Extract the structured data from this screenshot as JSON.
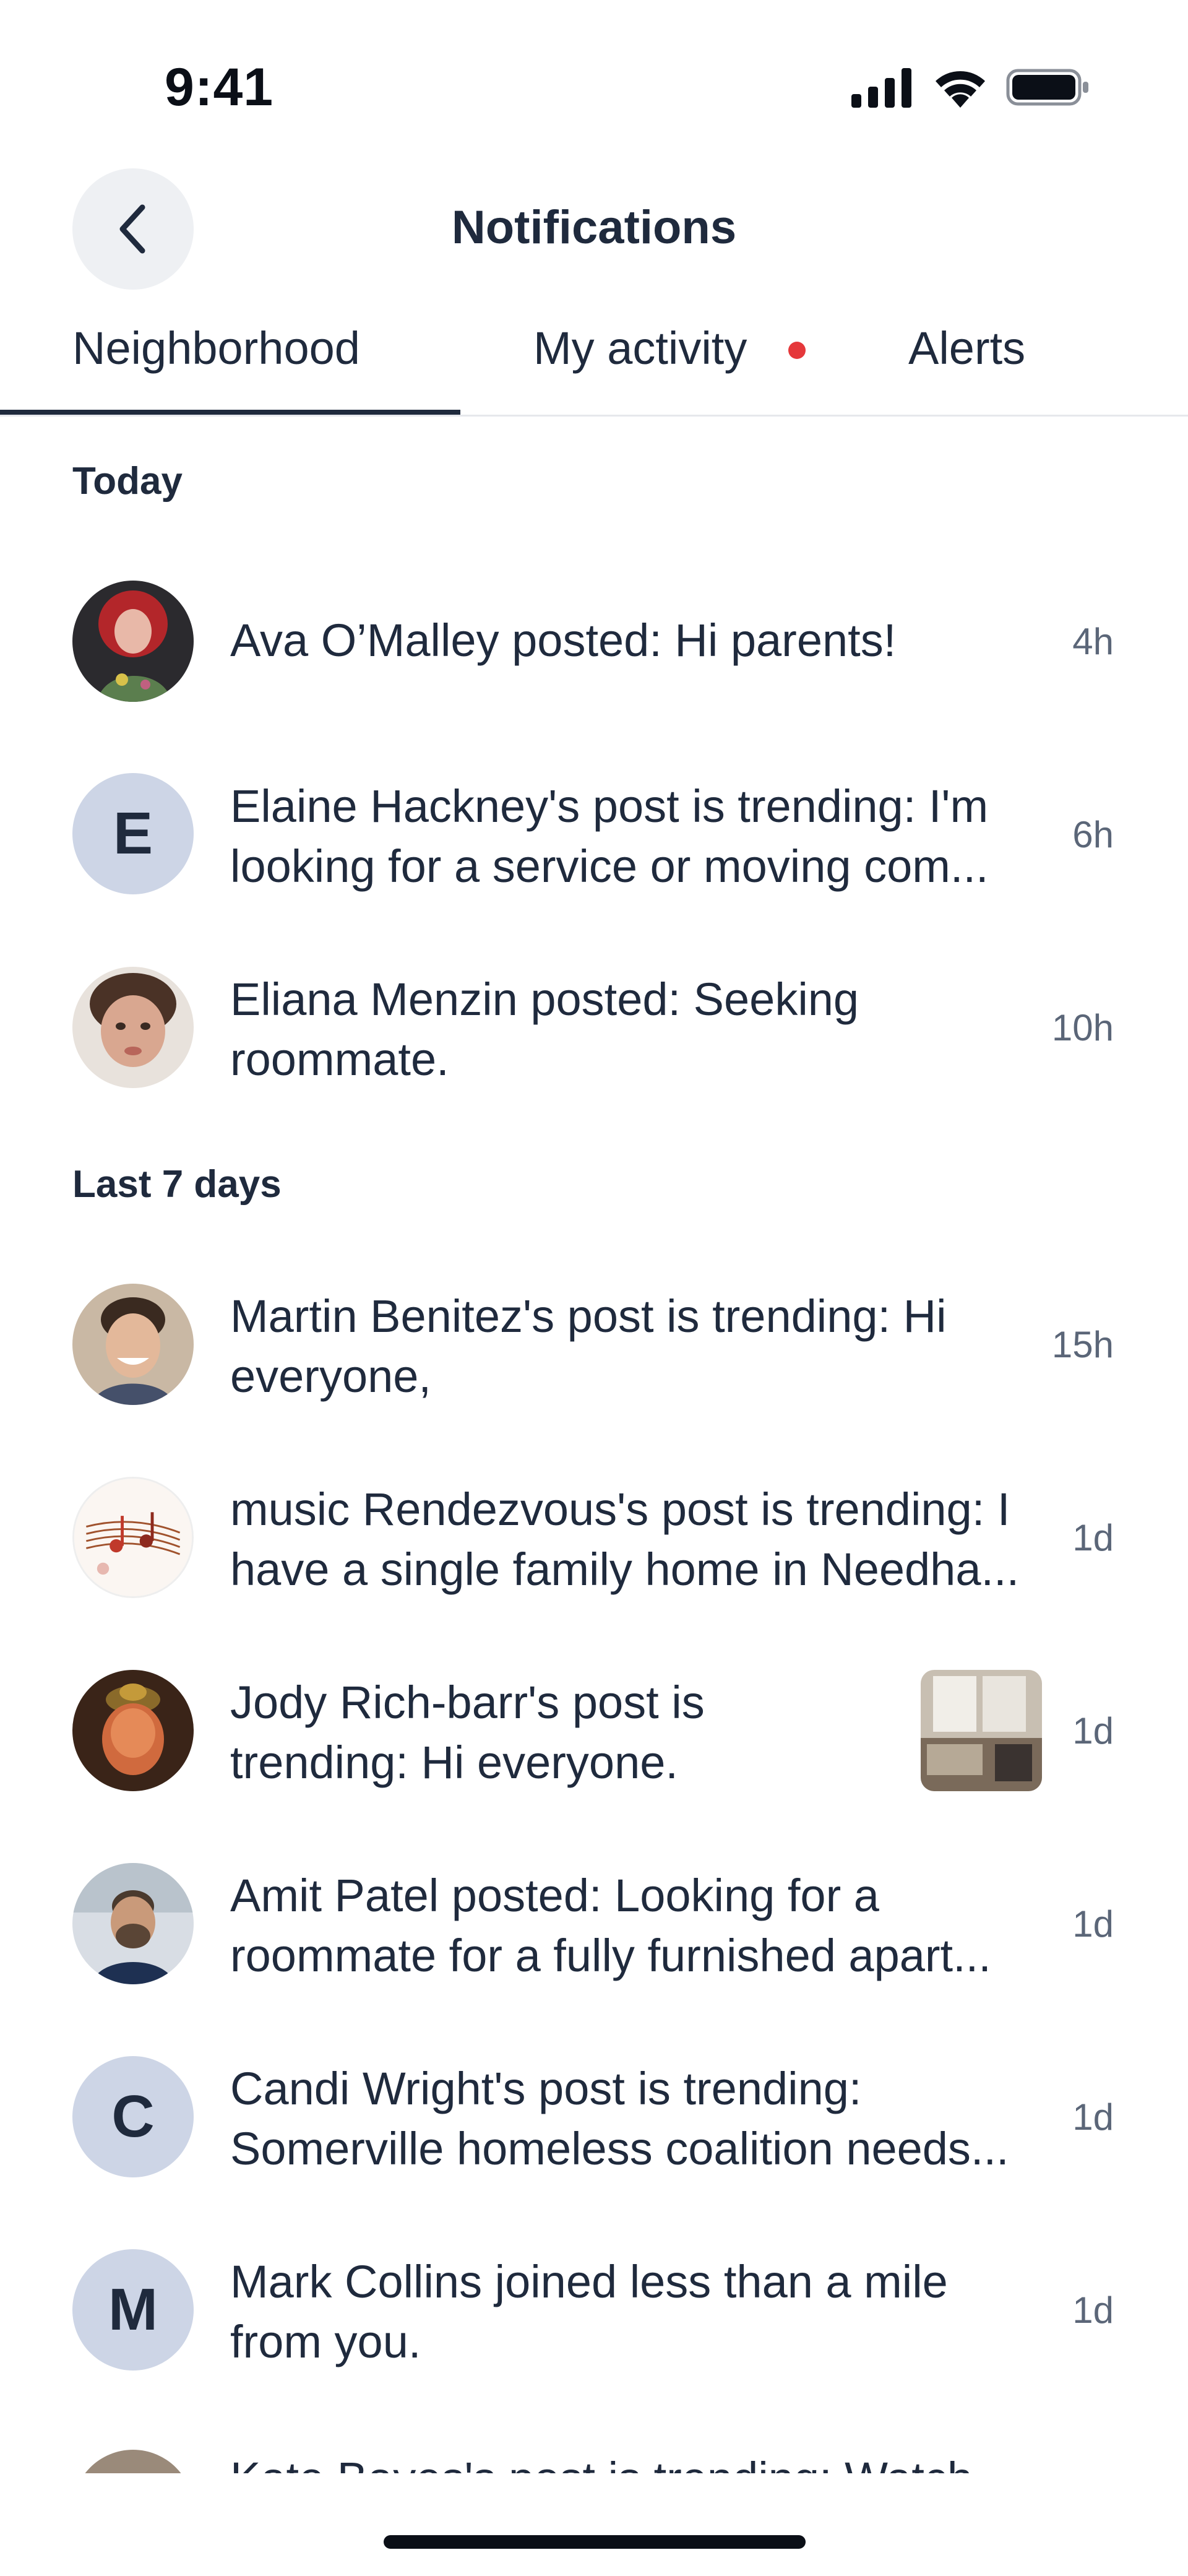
{
  "status_bar": {
    "time": "9:41"
  },
  "header": {
    "title": "Notifications"
  },
  "tabs": [
    {
      "label": "Neighborhood",
      "selected": true
    },
    {
      "label": "My activity",
      "has_dot": true
    },
    {
      "label": "Alerts"
    }
  ],
  "sections": [
    {
      "label": "Today",
      "items": [
        {
          "avatar": "photo-red-hair-woman",
          "lines": [
            "Ava O’Malley posted: Hi parents!"
          ],
          "time": "4h"
        },
        {
          "avatar_letter": "E",
          "lines": [
            "Elaine Hackney's post is trending: I'm",
            "looking for a service or moving com..."
          ],
          "time": "6h"
        },
        {
          "avatar": "photo-woman-selfie",
          "lines": [
            "Eliana Menzin posted: Seeking",
            "roommate."
          ],
          "time": "10h"
        }
      ]
    },
    {
      "label": "Last 7 days",
      "items": [
        {
          "avatar": "photo-smiling-man",
          "lines": [
            "Martin Benitez's post is trending: Hi",
            "everyone,"
          ],
          "time": "15h"
        },
        {
          "avatar": "music-notes-image",
          "lines": [
            "music Rendezvous's post is trending: I",
            "have a single family home in Needha..."
          ],
          "time": "1d"
        },
        {
          "avatar": "photo-woman-hat",
          "lines": [
            "Jody Rich-barr's post is",
            "trending: Hi everyone."
          ],
          "time": "1d",
          "thumbnail": "kitchen-photo"
        },
        {
          "avatar": "photo-man-beard",
          "lines": [
            "Amit Patel posted: Looking for a",
            "roommate for a fully furnished apart..."
          ],
          "time": "1d"
        },
        {
          "avatar_letter": "C",
          "lines": [
            "Candi Wright's post is trending:",
            "Somerville homeless coalition needs..."
          ],
          "time": "1d"
        },
        {
          "avatar_letter": "M",
          "lines": [
            "Mark Collins joined less than a mile",
            "from you."
          ],
          "time": "1d"
        }
      ]
    }
  ],
  "clipped_row": {
    "text": "Kate Bayes's post is trending: Watch"
  },
  "colors": {
    "text": "#1f2a3d",
    "muted": "#5b6678",
    "letter_avatar_bg": "#cdd5e6",
    "dot": "#e5383b"
  }
}
